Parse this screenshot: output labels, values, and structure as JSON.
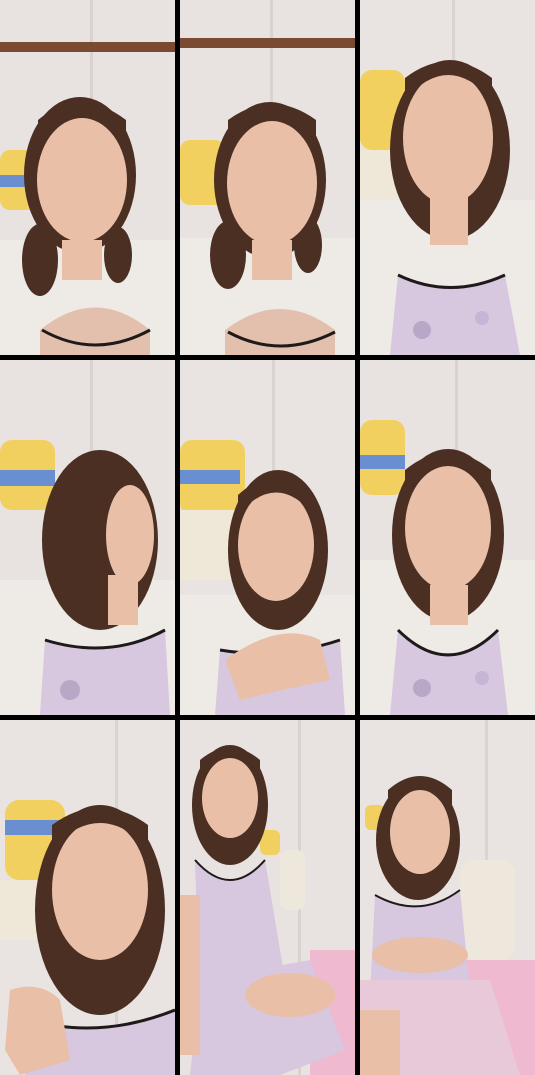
{
  "collage": {
    "rows": 3,
    "cols": 3,
    "tiles": [
      {
        "pose": "face-closeup-pigtails",
        "crop": "upper-body",
        "top": "white-cardigan"
      },
      {
        "pose": "face-closeup-pigtails-talking",
        "crop": "upper-body",
        "top": "white-cardigan"
      },
      {
        "pose": "eyes-closed-hair-down",
        "crop": "upper-body",
        "top": "lavender-floral-camisole"
      },
      {
        "pose": "profile-facing-right",
        "crop": "upper-body",
        "top": "lavender-floral-camisole"
      },
      {
        "pose": "hand-at-chest",
        "crop": "upper-body",
        "top": "lavender-floral-camisole"
      },
      {
        "pose": "looking-down-frontal",
        "crop": "upper-body",
        "top": "lavender-floral-camisole"
      },
      {
        "pose": "hand-gesture-talking",
        "crop": "close",
        "top": "lavender-floral-camisole"
      },
      {
        "pose": "seated-knees-up",
        "crop": "full-body",
        "top": "lavender-floral-slip"
      },
      {
        "pose": "seated-pink-blanket",
        "crop": "full-body",
        "top": "lavender-floral-slip"
      }
    ]
  },
  "colors": {
    "wall": "#e8e3e0",
    "wall_shadow": "#d6d0cc",
    "hair": "#4a2f22",
    "skin": "#e9bfa8",
    "cardigan": "#eeeae6",
    "camisole": "#d7c7df",
    "plush": "#f2d060",
    "blanket": "#efb9cf",
    "sofa": "#eee8dc"
  }
}
